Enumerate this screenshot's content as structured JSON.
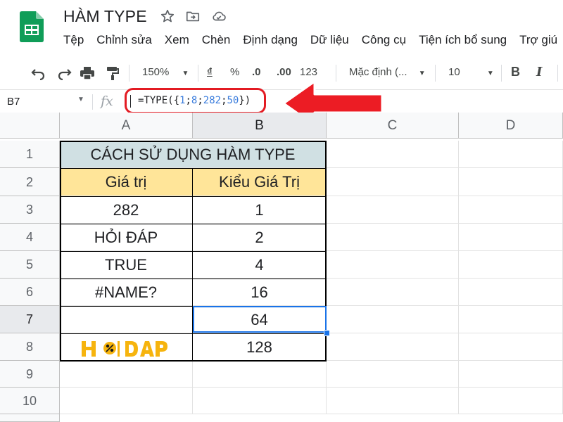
{
  "document": {
    "title": "HÀM TYPE"
  },
  "menu": [
    "Tệp",
    "Chỉnh sửa",
    "Xem",
    "Chèn",
    "Định dạng",
    "Dữ liệu",
    "Công cụ",
    "Tiện ích bổ sung",
    "Trợ giú"
  ],
  "toolbar": {
    "zoom": "150%",
    "currency": "₫",
    "percent": "%",
    "decrease_decimal": ".0",
    "increase_decimal": ".00",
    "more_formats": "123",
    "font": "Mặc định (...",
    "font_size": "10",
    "bold": "B",
    "italic": "I"
  },
  "formula_bar": {
    "cell_ref": "B7",
    "fx": "fx",
    "formula_prefix": "=TYPE({",
    "formula_args": [
      "1",
      "8",
      "282",
      "50"
    ],
    "formula_suffix": "})"
  },
  "columns": [
    "A",
    "B",
    "C",
    "D"
  ],
  "rows": [
    "1",
    "2",
    "3",
    "4",
    "5",
    "6",
    "7",
    "8",
    "9",
    "10"
  ],
  "sheet": {
    "title": "CÁCH SỬ DỤNG HÀM TYPE",
    "header_value": "Giá trị",
    "header_type": "Kiểu Giá Trị",
    "values": [
      "282",
      "HỎI ĐÁP",
      "TRUE",
      "#NAME?",
      "",
      ""
    ],
    "types": [
      "1",
      "2",
      "4",
      "16",
      "64",
      "128"
    ]
  },
  "logo_text": "HỎI ĐÁP",
  "colors": {
    "title_bg": "#d0e0e3",
    "header_bg": "#ffe599",
    "selection": "#1a73e8",
    "annotation": "#e31b23",
    "sheets_green": "#0f9d58"
  }
}
